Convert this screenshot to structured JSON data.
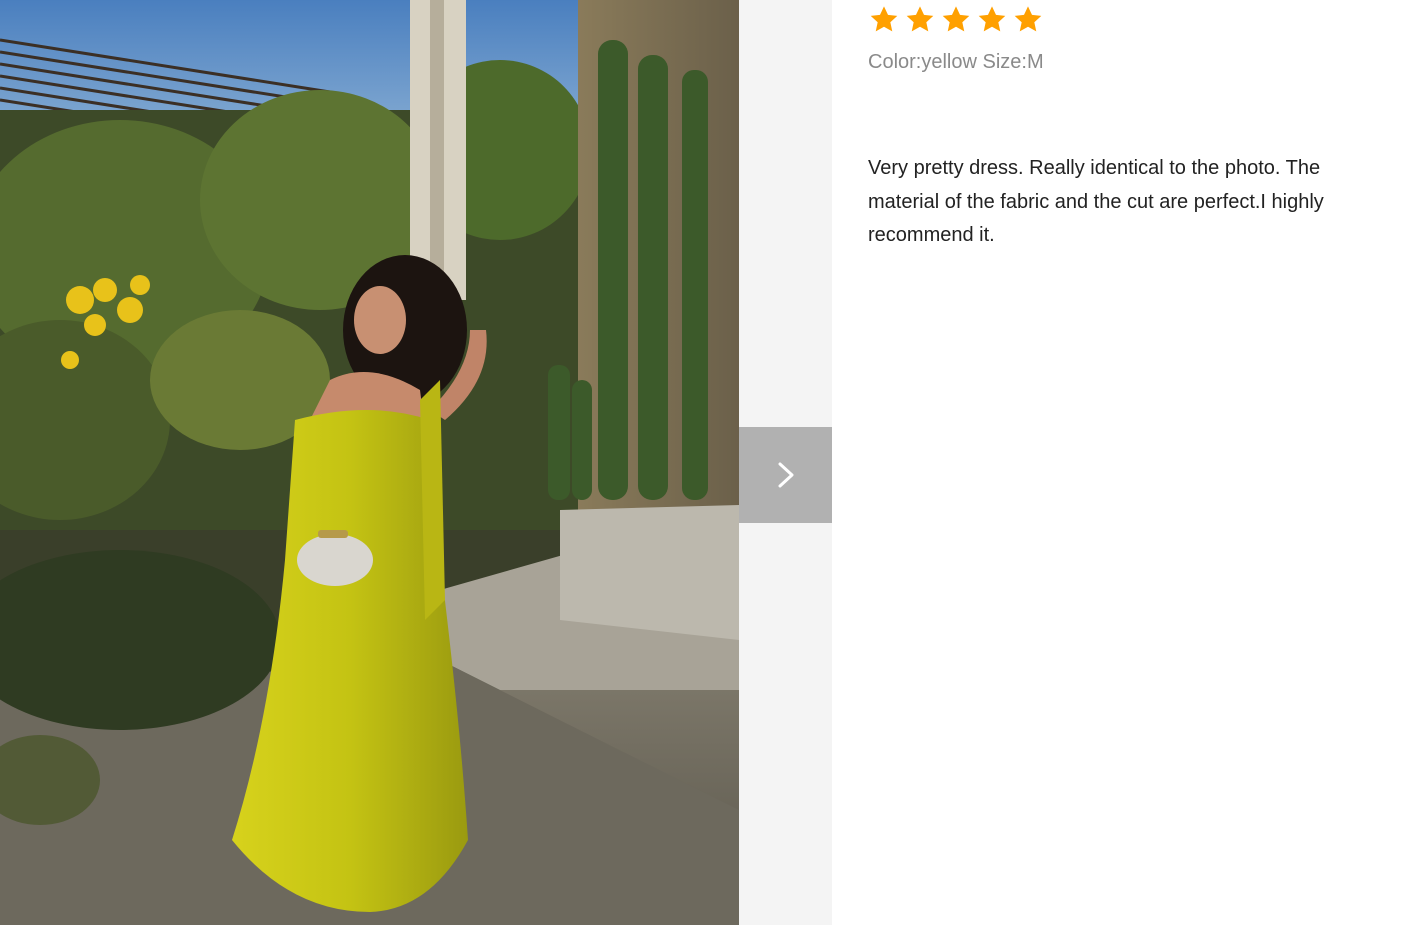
{
  "review": {
    "rating": 5,
    "rating_max": 5,
    "star_color": "#ffa000",
    "variant": "Color:yellow Size:M",
    "text": "Very pretty dress. Really identical to the photo. The material of the fabric and the cut are perfect.I highly recommend it."
  },
  "gallery": {
    "next_icon": "chevron-right-icon",
    "photo_subject": "review photo"
  },
  "colors": {
    "gutter": "#f4f4f4",
    "next_button": "#b1b1b1",
    "variant_text": "#8a8a8a",
    "review_text": "#222222"
  }
}
